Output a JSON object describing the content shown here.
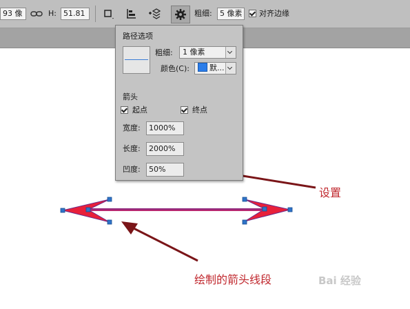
{
  "toolbar": {
    "w_value": "93 像",
    "h_label": "H:",
    "h_value": "51.81",
    "weight_label": "粗细:",
    "weight_value": "5 像素",
    "align_edges_label": "对齐边缘",
    "align_edges_checked": true,
    "icons": [
      "link-icon",
      "path-operations-icon",
      "path-alignment-icon",
      "path-arrangement-icon",
      "gear-icon"
    ]
  },
  "popup": {
    "title": "路径选项",
    "weight_label": "粗细:",
    "weight_value": "1 像素",
    "color_label": "颜色(C):",
    "color_value": "默...",
    "color_swatch": "#2b7de9",
    "arrowheads_label": "箭头",
    "start_label": "起点",
    "start_checked": true,
    "end_label": "终点",
    "end_checked": true,
    "width_label": "宽度:",
    "width_value": "1000%",
    "length_label": "长度:",
    "length_value": "2000%",
    "concavity_label": "凹度:",
    "concavity_value": "50%"
  },
  "annotations": {
    "settings": "设置",
    "drawn_arrow": "绘制的箭头线段",
    "color": "#c0272d"
  },
  "watermark": "Bai 经验"
}
